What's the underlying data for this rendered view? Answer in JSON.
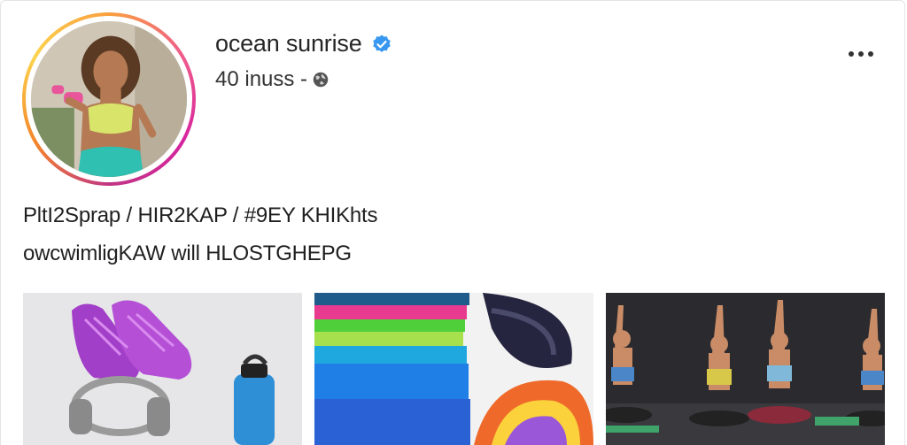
{
  "profile": {
    "username": "ocean sunrise",
    "stat_text": "40 inuss -",
    "verified": true,
    "bio_line_1": "PltI2Sprap / HIR2KAP / #9EY KHIKhts",
    "bio_line_2": "owcwimligKAW will HLOSTGHEPG"
  },
  "colors": {
    "verified": "#3897f0",
    "ring_gradient": [
      "#f9a03f",
      "#ef5a8b",
      "#d6249f",
      "#c13584",
      "#fcd34d"
    ],
    "text": "#262626"
  },
  "posts": [
    {
      "icon": "sneakers-headphones-bottle"
    },
    {
      "icon": "resistance-bands"
    },
    {
      "icon": "yoga-class"
    }
  ]
}
